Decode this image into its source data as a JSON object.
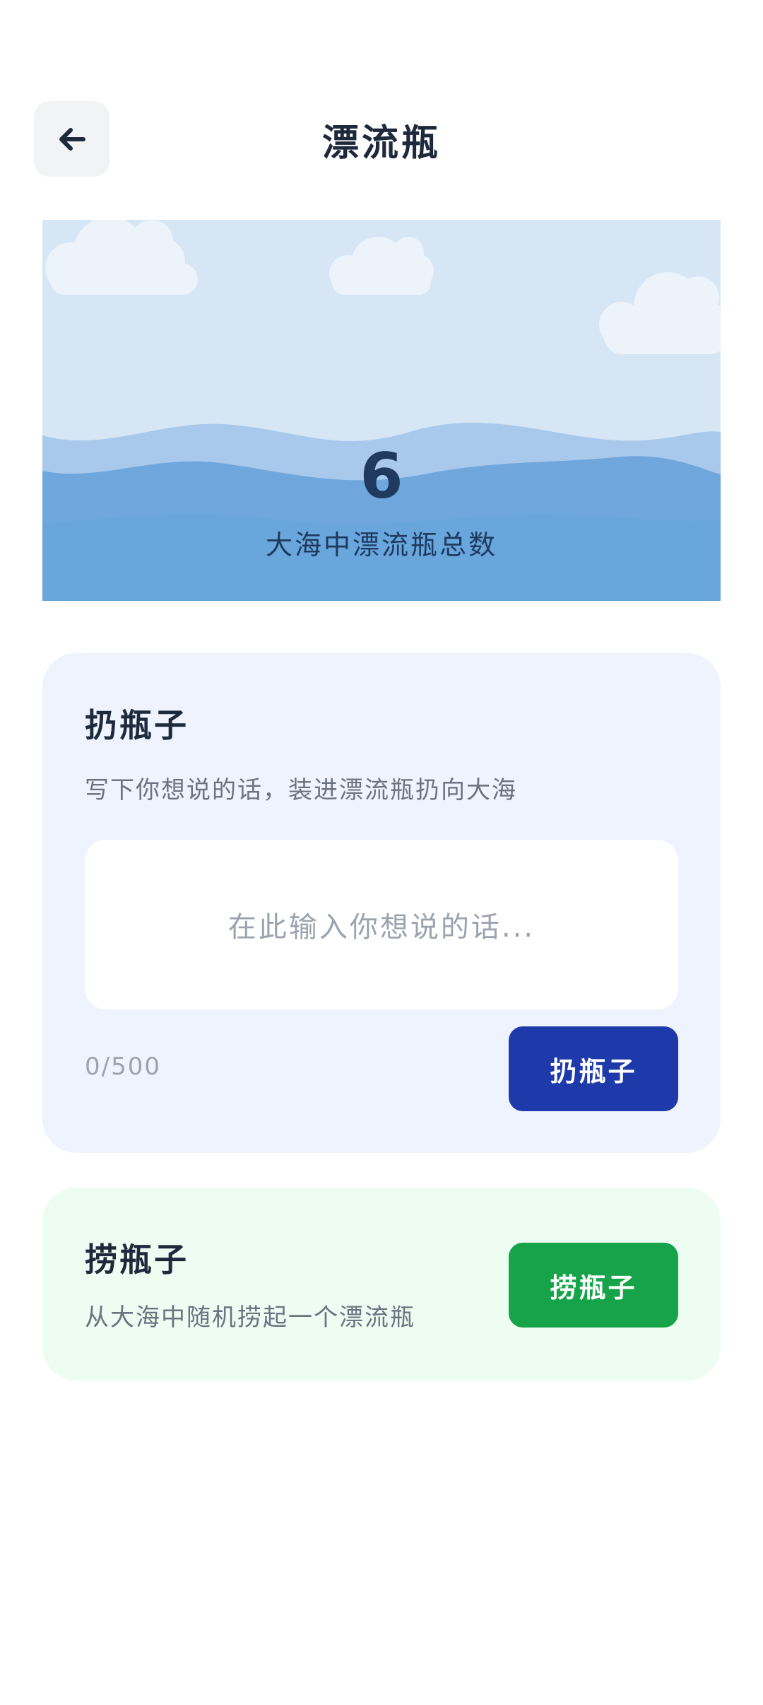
{
  "header": {
    "title": "漂流瓶",
    "back_icon": "arrow-left-icon"
  },
  "sea": {
    "bottle_count": "6",
    "count_label": "大海中漂流瓶总数",
    "colors": {
      "sky": "#d6e6f5",
      "wave_light": "#a8c9ec",
      "wave_mid": "#6fa6dc",
      "wave_deep": "#68a6dc",
      "cloud": "#ecf3fb"
    }
  },
  "throw_card": {
    "title": "扔瓶子",
    "description": "写下你想说的话，装进漂流瓶扔向大海",
    "input_placeholder": "在此输入你想说的话...",
    "char_count": "0/500",
    "button_label": "扔瓶子",
    "button_color": "#1e3aaa"
  },
  "pick_card": {
    "title": "捞瓶子",
    "description": "从大海中随机捞起一个漂流瓶",
    "button_label": "捞瓶子",
    "button_color": "#16a34a"
  }
}
